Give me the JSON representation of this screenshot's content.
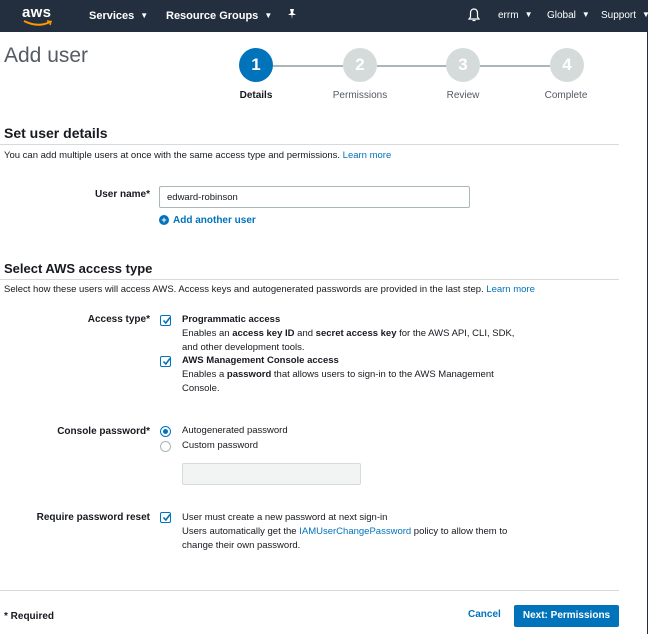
{
  "nav": {
    "logo": "aws",
    "services": "Services",
    "resource_groups": "Resource Groups",
    "pin_icon": "pin-icon",
    "bell_icon": "bell-icon",
    "account": "errm",
    "region": "Global",
    "support": "Support"
  },
  "page": {
    "title": "Add user"
  },
  "wizard": {
    "steps": [
      {
        "number": "1",
        "label": "Details",
        "active": true
      },
      {
        "number": "2",
        "label": "Permissions",
        "active": false
      },
      {
        "number": "3",
        "label": "Review",
        "active": false
      },
      {
        "number": "4",
        "label": "Complete",
        "active": false
      }
    ]
  },
  "details": {
    "title": "Set user details",
    "description": "You can add multiple users at once with the same access type and permissions.",
    "learn_more": "Learn more",
    "user_name_label": "User name*",
    "user_name_value": "edward-robinson",
    "add_another": "Add another user"
  },
  "access": {
    "title": "Select AWS access type",
    "description": "Select how these users will access AWS. Access keys and autogenerated passwords are provided in the last step.",
    "learn_more": "Learn more",
    "access_type_label": "Access type*",
    "programmatic": {
      "title": "Programmatic access",
      "line1_a": "Enables an ",
      "line1_b": "access key ID",
      "line1_c": " and ",
      "line1_d": "secret access key",
      "line1_e": " for the AWS API, CLI, SDK,",
      "line2": "and other development tools.",
      "checked": true
    },
    "console": {
      "title": "AWS Management Console access",
      "line1_a": "Enables a ",
      "line1_b": "password",
      "line1_c": " that allows users to sign-in to the AWS Management",
      "line2": "Console.",
      "checked": true
    },
    "console_password_label": "Console password*",
    "autogenerated": "Autogenerated password",
    "custom": "Custom password",
    "selected_password": "Autogenerated password",
    "reset_label": "Require password reset",
    "reset_title": "User must create a new password at next sign-in",
    "reset_line1_a": "Users automatically get the ",
    "reset_policy": "IAMUserChangePassword",
    "reset_line1_b": " policy to allow them to",
    "reset_line2": "change their own password.",
    "reset_checked": true
  },
  "footer": {
    "required": "* Required",
    "cancel": "Cancel",
    "next": "Next: Permissions"
  },
  "colors": {
    "nav_bg": "#232f3e",
    "accent": "#0073bb",
    "inactive_step": "#d5dbdb"
  }
}
